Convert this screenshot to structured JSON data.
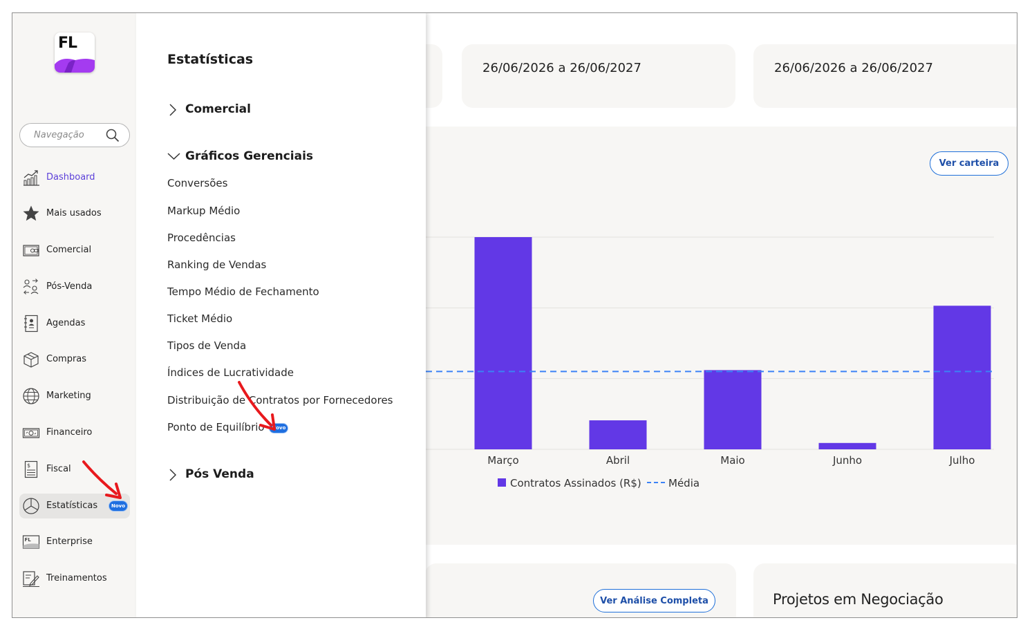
{
  "header_cards": [
    {
      "date_range": "26/06/2026 a 26/06/2027"
    },
    {
      "date_range": "26/06/2026 a 26/06/2027"
    }
  ],
  "buttons": {
    "ver_carteira": "Ver carteira",
    "ver_analise": "Ver Análise Completa"
  },
  "projetos_title": "Projetos em Negociação",
  "chart_data": {
    "type": "bar",
    "categories": [
      "Março",
      "Abril",
      "Maio",
      "Junho",
      "Julho"
    ],
    "series": [
      {
        "name": "Contratos Assinados (R$)",
        "values": [
          300,
          41,
          112,
          9,
          203
        ],
        "color": "#6238e6"
      }
    ],
    "average": {
      "name": "Média",
      "value": 110,
      "color": "#3b82f6"
    },
    "ylim": [
      0,
      300
    ],
    "grid": true,
    "legend_position": "bottom"
  },
  "sidebar": {
    "search_placeholder": "Navegação",
    "items": [
      {
        "label": "Dashboard",
        "icon": "chart-growth-icon",
        "selected": true
      },
      {
        "label": "Mais usados",
        "icon": "star-icon"
      },
      {
        "label": "Comercial",
        "icon": "wallet-icon"
      },
      {
        "label": "Pós-Venda",
        "icon": "users-exchange-icon"
      },
      {
        "label": "Agendas",
        "icon": "contact-book-icon"
      },
      {
        "label": "Compras",
        "icon": "box-icon"
      },
      {
        "label": "Marketing",
        "icon": "globe-icon"
      },
      {
        "label": "Financeiro",
        "icon": "money-icon"
      },
      {
        "label": "Fiscal",
        "icon": "receipt-icon"
      },
      {
        "label": "Estatísticas",
        "icon": "pie-chart-icon",
        "badge": "Novo",
        "active": true
      },
      {
        "label": "Enterprise",
        "icon": "enterprise-icon"
      },
      {
        "label": "Treinamentos",
        "icon": "training-icon"
      }
    ]
  },
  "submenu": {
    "title": "Estatísticas",
    "sections": [
      {
        "label": "Comercial",
        "expanded": false
      },
      {
        "label": "Gráficos Gerenciais",
        "expanded": true
      },
      {
        "label": "Pós Venda",
        "expanded": false
      }
    ],
    "items": [
      {
        "label": "Conversões"
      },
      {
        "label": "Markup Médio"
      },
      {
        "label": "Procedências"
      },
      {
        "label": "Ranking de Vendas"
      },
      {
        "label": "Tempo Médio de Fechamento"
      },
      {
        "label": "Ticket Médio"
      },
      {
        "label": "Tipos de Venda"
      },
      {
        "label": "Índices de Lucratividade"
      },
      {
        "label": "Distribuição de Contratos por Fornecedores"
      },
      {
        "label": "Ponto de Equilíbrio",
        "badge": "Novo"
      }
    ]
  },
  "colors": {
    "accent": "#5b3fd9",
    "bar": "#6238e6",
    "badge": "#1f6fe0",
    "annotation_arrow": "#e8191d"
  }
}
